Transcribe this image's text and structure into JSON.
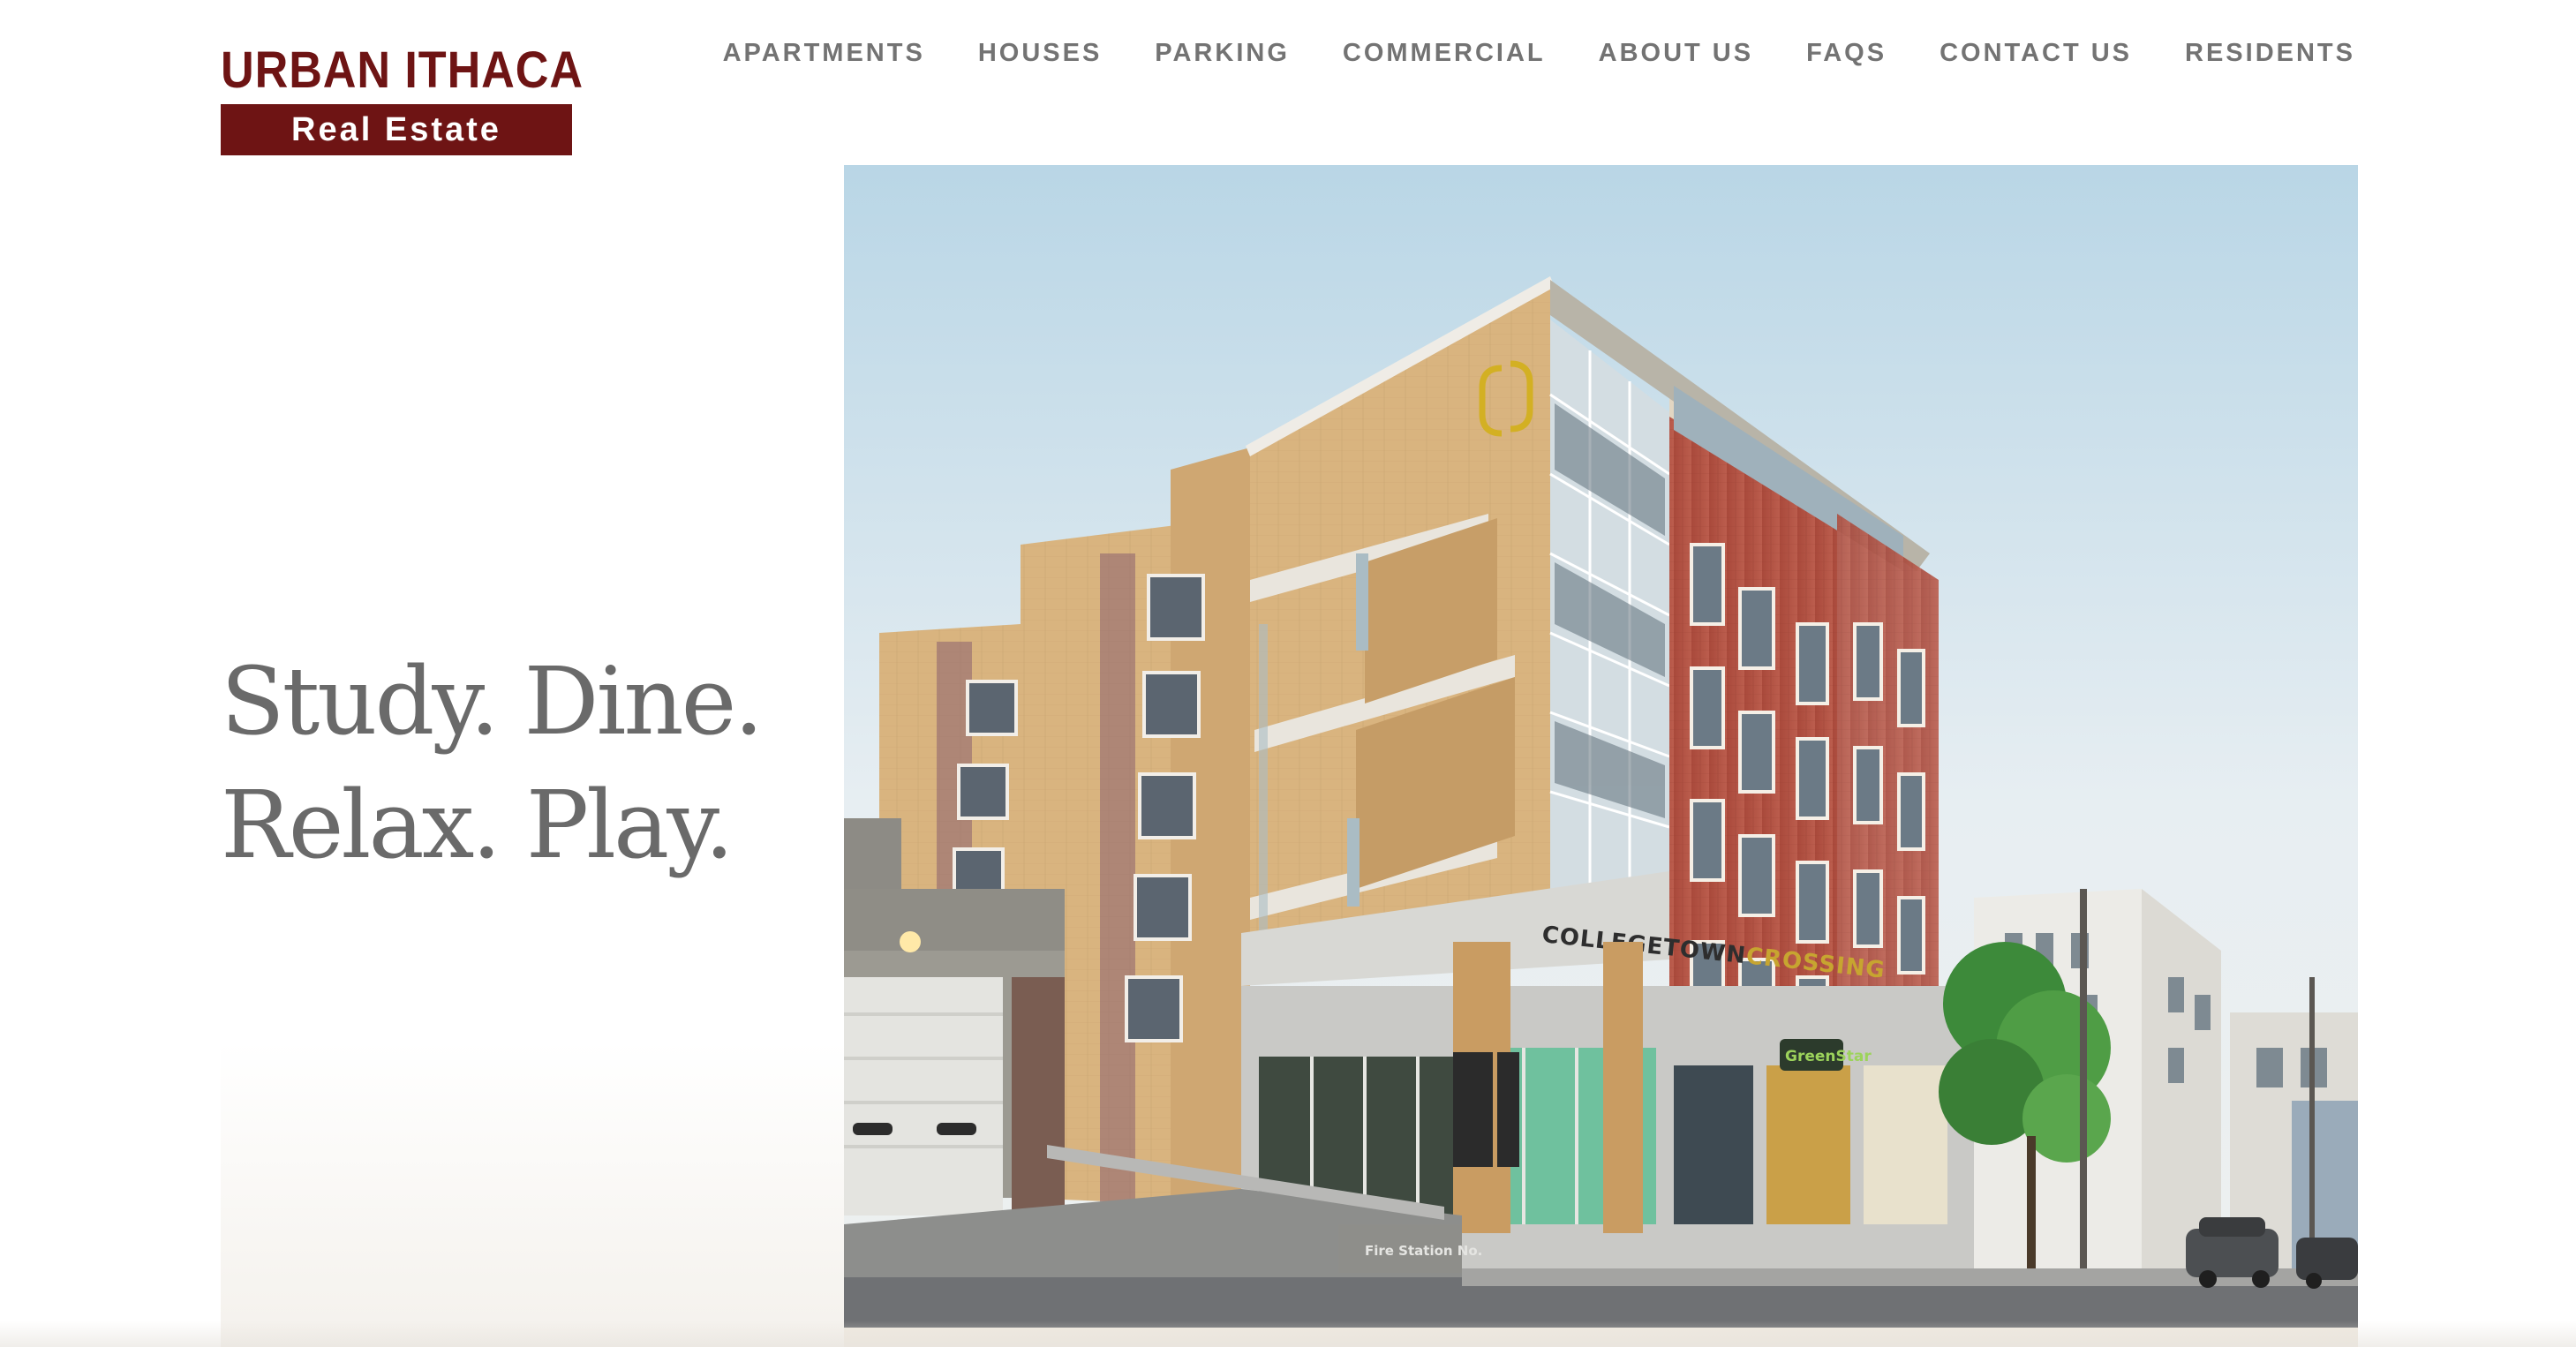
{
  "brand": {
    "title": "URBAN ITHACA",
    "subtitle": "Real Estate",
    "color": "#6e1414"
  },
  "nav": {
    "items": [
      {
        "label": "APARTMENTS"
      },
      {
        "label": "HOUSES"
      },
      {
        "label": "PARKING"
      },
      {
        "label": "COMMERCIAL"
      },
      {
        "label": "ABOUT US"
      },
      {
        "label": "FAQS"
      },
      {
        "label": "CONTACT US"
      },
      {
        "label": "RESIDENTS"
      }
    ]
  },
  "hero": {
    "line1": "Study. Dine.",
    "line2": "Relax. Play.",
    "image": {
      "building_sign": "COLLEGETOWN",
      "building_sign_accent": "CROSSING",
      "store_sign": "GreenStar",
      "station_sign": "Fire Station No."
    }
  }
}
